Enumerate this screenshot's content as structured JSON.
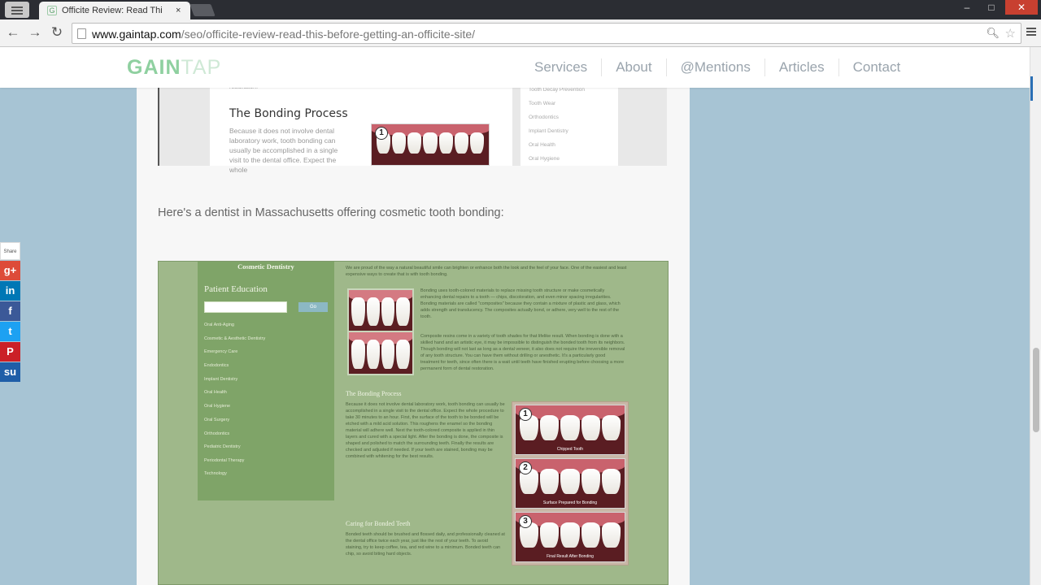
{
  "browser": {
    "tab_title": "Officite Review: Read Thi",
    "tab_close": "×",
    "url_host": "www.gaintap.com",
    "url_path": "/seo/officite-review-read-this-before-getting-an-officite-site/",
    "back_glyph": "←",
    "forward_glyph": "→",
    "reload_glyph": "↻",
    "window_minimize": "–",
    "window_maximize": "□",
    "window_close": "✕",
    "icons": [
      "back-icon",
      "forward-icon",
      "reload-icon",
      "page-icon",
      "search-icon",
      "bookmark-star-icon",
      "chrome-menu-icon"
    ]
  },
  "site": {
    "logo_gain": "GAIN",
    "logo_tap": "TAP",
    "nav": [
      "Services",
      "About",
      "@Mentions",
      "Articles",
      "Contact"
    ],
    "accent": "#8fd0a0"
  },
  "shot1": {
    "top_text": "restoration.",
    "heading": "The Bonding Process",
    "body": "Because it does not involve dental laboratory work, tooth bonding can usually be accomplished in a single visit to the dental office. Expect the whole",
    "step_number": "1",
    "side_links": [
      "Tooth Decay Prevention",
      "Tooth Wear",
      "Orthodontics",
      "Implant Dentistry",
      "Oral Health",
      "Oral Hygiene"
    ]
  },
  "article": {
    "intro": "Here's a dentist in Massachusetts offering cosmetic tooth bonding:"
  },
  "shot2": {
    "cosmetic_title": "Cosmetic Dentistry",
    "patient_education": "Patient Education",
    "go_label": "Go",
    "sidebar_links": [
      "Oral Anti-Aging",
      "Cosmetic & Aesthetic Dentistry",
      "Emergency Care",
      "Endodontics",
      "Implant Dentistry",
      "Oral Health",
      "Oral Hygiene",
      "Oral Surgery",
      "Orthodontics",
      "Pediatric Dentistry",
      "Periodontal Therapy",
      "Technology"
    ],
    "intro": "We are proud of the way a natural beautiful smile can brighten or enhance both the look and the feel of your face. One of the easiest and least expensive ways to create that is with tooth bonding.",
    "para1": "Bonding uses tooth-colored materials to replace missing tooth structure or make cosmetically enhancing dental repairs to a tooth — chips, discoloration, and even minor spacing irregularities. Bonding materials are called \"composites\" because they contain a mixture of plastic and glass, which adds strength and translucency. The composites actually bond, or adhere, very well to the rest of the tooth.",
    "para2": "Composite resins come in a variety of tooth shades for that lifelike result. When bonding is done with a skilled hand and an artistic eye, it may be impossible to distinguish the bonded tooth from its neighbors. Though bonding will not last as long as a dental veneer, it also does not require the irreversible removal of any tooth structure. You can have them without drilling or anesthetic. It's a particularly good treatment for teeth, since often there is a wait until teeth have finished erupting before choosing a more permanent form of dental restoration.",
    "bonding_heading": "The Bonding Process",
    "bonding_text": "Because it does not involve dental laboratory work, tooth bonding can usually be accomplished in a single visit to the dental office. Expect the whole procedure to take 30 minutes to an hour. First, the surface of the tooth to be bonded will be etched with a mild acid solution. This roughens the enamel so the bonding material will adhere well. Next the tooth-colored composite is applied in thin layers and cured with a special light. After the bonding is done, the composite is shaped and polished to match the surrounding teeth. Finally the results are checked and adjusted if needed. If your teeth are stained, bonding may be combined with whitening for the best results.",
    "care_heading": "Caring for Bonded Teeth",
    "care_text": "Bonded teeth should be brushed and flossed daily, and professionally cleaned at the dental office twice each year, just like the rest of your teeth. To avoid staining, try to keep coffee, tea, and red wine to a minimum. Bonded teeth can chip, so avoid biting hard objects.",
    "steps": [
      {
        "number": "1",
        "caption": "Chipped Tooth"
      },
      {
        "number": "2",
        "caption": "Surface Prepared for Bonding"
      },
      {
        "number": "3",
        "caption": "Final Result After Bonding"
      }
    ]
  },
  "share": {
    "count_label": "Share",
    "buttons": [
      {
        "glyph": "g+",
        "color": "#dd4b39"
      },
      {
        "glyph": "in",
        "color": "#0077b5"
      },
      {
        "glyph": "f",
        "color": "#3b5998"
      },
      {
        "glyph": "t",
        "color": "#1da1f2"
      },
      {
        "glyph": "P",
        "color": "#cb2027"
      },
      {
        "glyph": "su",
        "color": "#1f5ea8"
      }
    ]
  }
}
